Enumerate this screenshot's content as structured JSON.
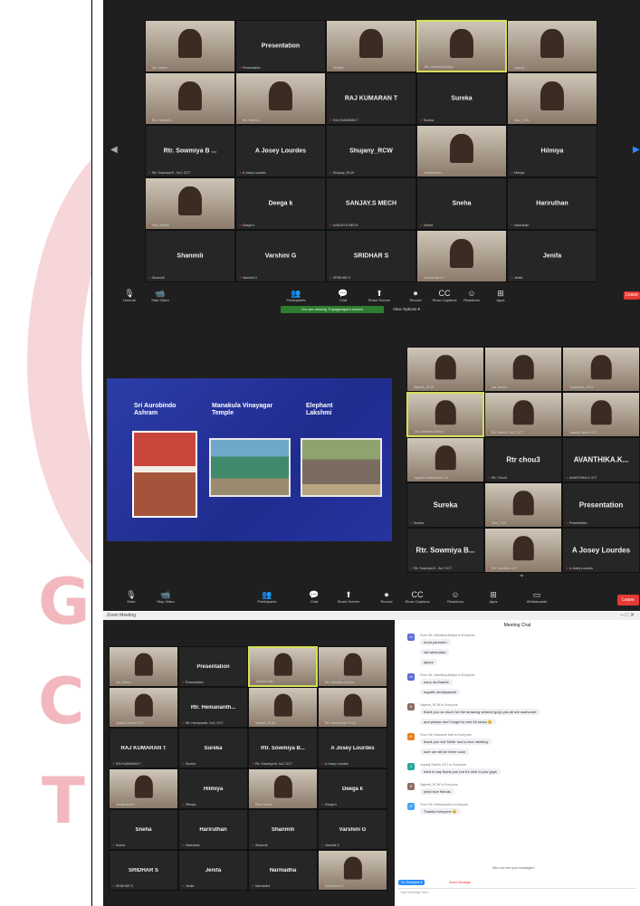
{
  "colors": {
    "zoom_dark": "#1f1f1f",
    "tile": "#262626",
    "end_red": "#e53935",
    "share_green": "#2e7d32",
    "slide_blue": "#2733a0",
    "watermark": "#f2b8bd"
  },
  "watermark": {
    "letters": [
      "G",
      "C",
      "T"
    ]
  },
  "panel1": {
    "tiles": [
      {
        "name": "",
        "label": "Ma. Selam...",
        "photo": true
      },
      {
        "name": "Presentation",
        "label": "Presentation",
        "photo": false
      },
      {
        "name": "",
        "label": "Srivathi...",
        "photo": true
      },
      {
        "name": "",
        "label": "Ms. Hanifsha Athilya",
        "photo": true,
        "hl": true
      },
      {
        "name": "",
        "label": "Jeyaraj ...",
        "photo": true
      },
      {
        "name": "",
        "label": "Rtr. Hameeth...",
        "photo": true
      },
      {
        "name": "",
        "label": "Rtr. Harrish...",
        "photo": true
      },
      {
        "name": "RAJ KUMARAN T",
        "label": "RAJ KUMARAN T",
        "photo": false
      },
      {
        "name": "Sureka",
        "label": "Sureka",
        "photo": false
      },
      {
        "name": "",
        "label": "Vinu_TCN",
        "photo": true
      },
      {
        "name": "Rtr. Sowmiya B ...",
        "label": "Rtr. Sowmiya B - SoC GCT",
        "photo": false
      },
      {
        "name": "A Josey Lourdes",
        "label": "A Josey Lourdes",
        "photo": false
      },
      {
        "name": "Shujany_RCW",
        "label": "Shujany_RCW",
        "photo": false
      },
      {
        "name": "",
        "label": "Janakiraman ...",
        "photo": true
      },
      {
        "name": "Hilmiya",
        "label": "Hilmiya",
        "photo": false
      },
      {
        "name": "",
        "label": "Ritvy Hiraka",
        "photo": true
      },
      {
        "name": "Deega k",
        "label": "Deega k",
        "photo": false
      },
      {
        "name": "SANJAY.S MECH",
        "label": "SANJAY.S MECH",
        "photo": false
      },
      {
        "name": "Sneha",
        "label": "Sneha",
        "photo": false
      },
      {
        "name": "Hariruthan",
        "label": "Hariruthan",
        "photo": false
      },
      {
        "name": "Shanmili",
        "label": "Shanmili",
        "photo": false
      },
      {
        "name": "Varshini G",
        "label": "Varshini G",
        "photo": false
      },
      {
        "name": "SRIDHAR S",
        "label": "SRIDHAR S",
        "photo": false
      },
      {
        "name": "",
        "label": "Madha Mitra S",
        "photo": true
      },
      {
        "name": "Jenifa",
        "label": "Jenifa",
        "photo": false
      }
    ],
    "controls": [
      {
        "icon": "🎙",
        "label": "Unmute"
      },
      {
        "icon": "📹",
        "label": "Start Video"
      },
      {
        "icon": "👥",
        "label": "Participants"
      },
      {
        "icon": "💬",
        "label": "Chat"
      },
      {
        "icon": "⬆",
        "label": "Share Screen"
      },
      {
        "icon": "⏺",
        "label": "Record"
      },
      {
        "icon": "CC",
        "label": "Show Captions"
      },
      {
        "icon": "☺",
        "label": "Reactions"
      },
      {
        "icon": "⊞",
        "label": "Apps"
      }
    ],
    "banner": "You are viewing Thiyagarajan's screen",
    "view_options": "View Options ▾",
    "end_label": "Leave"
  },
  "panel2": {
    "slide": {
      "titles": [
        "Sri Aurobindo Ashram",
        "Manakula Vinayagar Temple",
        "Elephant Lakshmi"
      ]
    },
    "tiles": [
      {
        "name": "",
        "label": "Sajeeth_RCW",
        "photo": true
      },
      {
        "name": "",
        "label": "Ma. Selam ...",
        "photo": true
      },
      {
        "name": "",
        "label": "Thamizhta_RCW",
        "photo": true
      },
      {
        "name": "",
        "label": "Ms. Hanifsha Athilya",
        "photo": true,
        "hl": true
      },
      {
        "name": "",
        "label": "Rtr. Harrish. SoC GCT",
        "photo": true
      },
      {
        "name": "",
        "label": "Jeyaraj Sachin GCT",
        "photo": true
      },
      {
        "name": "",
        "label": "Jayanthi Mathivathan, M...",
        "photo": true
      },
      {
        "name": "Rtr chou3",
        "label": "Rtr. Chou3",
        "photo": false
      },
      {
        "name": "AVANTHIKA.K...",
        "label": "AVANTHIKA.K GCT",
        "photo": false
      },
      {
        "name": "Sureka",
        "label": "Sureka",
        "photo": false
      },
      {
        "name": "",
        "label": "Vinu_TCN",
        "photo": true
      },
      {
        "name": "Presentation",
        "label": "Presentation",
        "photo": false
      },
      {
        "name": "Rtr. Sowmiya B...",
        "label": "Rtr. Sowmiya B - SoC GCT",
        "photo": false
      },
      {
        "name": "",
        "label": "Ms. Hanifsha GCT",
        "photo": true
      },
      {
        "name": "A Josey Lourdes",
        "label": "A Josey Lourdes",
        "photo": false
      }
    ],
    "controls": [
      {
        "icon": "🎙",
        "label": "Mute"
      },
      {
        "icon": "📹",
        "label": "Stop Video"
      },
      {
        "icon": "👥",
        "label": "Participants"
      },
      {
        "icon": "💬",
        "label": "Chat"
      },
      {
        "icon": "⬆",
        "label": "Share Screen"
      },
      {
        "icon": "⏺",
        "label": "Record"
      },
      {
        "icon": "CC",
        "label": "Show Captions"
      },
      {
        "icon": "☺",
        "label": "Reactions"
      },
      {
        "icon": "⊞",
        "label": "Apps"
      },
      {
        "icon": "▭",
        "label": "Whiteboards"
      }
    ],
    "end_label": "Leave"
  },
  "panel3": {
    "window_title": "Zoom Meeting",
    "tiles": [
      {
        "name": "",
        "label": "Ma. Selam",
        "photo": true
      },
      {
        "name": "Presentation",
        "label": "Presentation",
        "photo": false
      },
      {
        "name": "",
        "label": "Srivathi Mal...",
        "photo": true,
        "hl": true
      },
      {
        "name": "",
        "label": "Ms. Hanifsha Athilya",
        "photo": true
      },
      {
        "name": "",
        "label": "Jeyaraj Sachin GCT",
        "photo": true
      },
      {
        "name": "Rtr. Hemananth...",
        "label": "Rtr. Hemananth. SoC GCT",
        "photo": false
      },
      {
        "name": "",
        "label": "Sajeeth_RCW",
        "photo": true
      },
      {
        "name": "",
        "label": "Rtr. Hemananth RCW",
        "photo": true
      },
      {
        "name": "RAJ KUMARAN T",
        "label": "RAJ KUMARAN T",
        "photo": false
      },
      {
        "name": "Sureka",
        "label": "Sureka",
        "photo": false
      },
      {
        "name": "Rtr. Sowmiya B...",
        "label": "Rtr. Sowmiya B. SoC GCT",
        "photo": false
      },
      {
        "name": "A Josey Lourdes",
        "label": "A Josey Lourdes",
        "photo": false
      },
      {
        "name": "",
        "label": "Janakiraman ...",
        "photo": true
      },
      {
        "name": "Hilmiya",
        "label": "Hilmiya",
        "photo": false
      },
      {
        "name": "",
        "label": "Ritvy Hiraka",
        "photo": true
      },
      {
        "name": "Deega k",
        "label": "Deega k",
        "photo": false
      },
      {
        "name": "Sneha",
        "label": "Sneha",
        "photo": false
      },
      {
        "name": "Hariruthan",
        "label": "Hariruthan",
        "photo": false
      },
      {
        "name": "Shanmili",
        "label": "Shanmili",
        "photo": false
      },
      {
        "name": "Varshini G",
        "label": "Varshini G",
        "photo": false
      },
      {
        "name": "SRIDHAR S",
        "label": "SRIDHAR S",
        "photo": false
      },
      {
        "name": "Jenifa",
        "label": "Jenifa",
        "photo": false
      },
      {
        "name": "Narmadha",
        "label": "Narmadha",
        "photo": false
      },
      {
        "name": "",
        "label": "Dhivyasree S",
        "photo": true
      }
    ],
    "chat": {
      "title": "Meeting Chat",
      "messages": [
        {
          "from": "From Ms. Hanifsha Athilya to Everyone",
          "avatar": "M",
          "color": "#5b6bd6",
          "lines": [
            "enna panneen",
            "nal wkshulran",
            "aguvo"
          ]
        },
        {
          "from": "From Ms. Hanifsha Athilya to Everyone",
          "avatar": "M",
          "color": "#5b6bd6",
          "lines": [
            "sorry da thambi",
            "nayalle nenaiyasinel"
          ]
        },
        {
          "from": "Sajeeth_RCW to Everyone",
          "avatar": "S",
          "color": "#8d6e63",
          "lines": [
            "thank you so much for the amazing session guys you all are awesome",
            "and please don't forget to visit Sri lanka 😊"
          ]
        },
        {
          "from": "From Rtr. Hameeth Hari to Everyone",
          "avatar": "R",
          "color": "#e67e22",
          "lines": [
            "thank you but 'Nelle' had a nice meeting",
            "sure we will be there soon"
          ]
        },
        {
          "from": "Jeyaraj Sachin GCT to Everyone",
          "avatar": "J",
          "color": "#26a69a",
          "lines": [
            "hard to say thank you but it's nice to you guys"
          ]
        },
        {
          "from": "Sajeeth_RCW to Everyone",
          "avatar": "S",
          "color": "#8d6e63",
          "lines": [
            "yeah true friends"
          ]
        },
        {
          "from": "From Rtr. Hemananth to Everyone",
          "avatar": "H",
          "color": "#42a5f5",
          "lines": [
            "Thanks everyone 😊"
          ]
        }
      ],
      "to_label": "To: Everyone ▾",
      "more_label": "Direct Message",
      "who_can_see": "Who can see your messages?",
      "placeholder": "Type message here..."
    }
  }
}
